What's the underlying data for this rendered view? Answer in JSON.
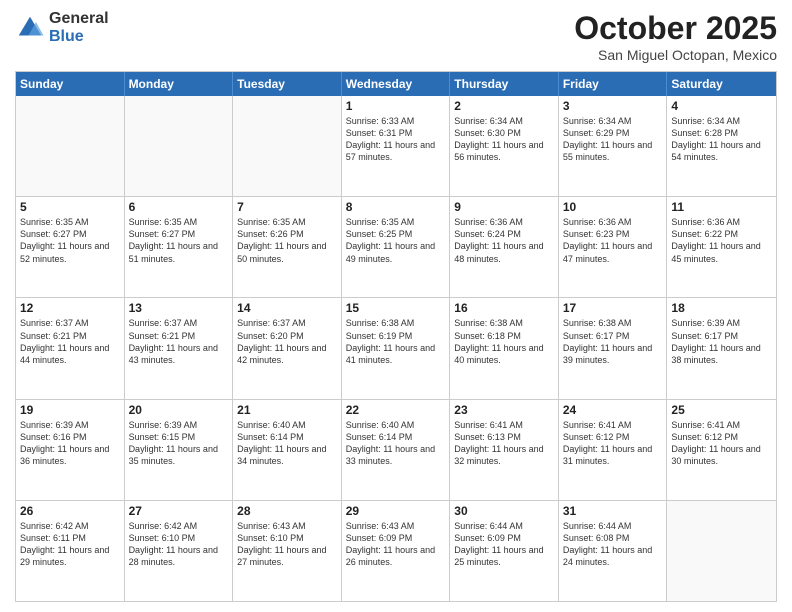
{
  "logo": {
    "general": "General",
    "blue": "Blue"
  },
  "header": {
    "month": "October 2025",
    "location": "San Miguel Octopan, Mexico"
  },
  "weekdays": [
    "Sunday",
    "Monday",
    "Tuesday",
    "Wednesday",
    "Thursday",
    "Friday",
    "Saturday"
  ],
  "rows": [
    [
      {
        "day": "",
        "info": ""
      },
      {
        "day": "",
        "info": ""
      },
      {
        "day": "",
        "info": ""
      },
      {
        "day": "1",
        "info": "Sunrise: 6:33 AM\nSunset: 6:31 PM\nDaylight: 11 hours\nand 57 minutes."
      },
      {
        "day": "2",
        "info": "Sunrise: 6:34 AM\nSunset: 6:30 PM\nDaylight: 11 hours\nand 56 minutes."
      },
      {
        "day": "3",
        "info": "Sunrise: 6:34 AM\nSunset: 6:29 PM\nDaylight: 11 hours\nand 55 minutes."
      },
      {
        "day": "4",
        "info": "Sunrise: 6:34 AM\nSunset: 6:28 PM\nDaylight: 11 hours\nand 54 minutes."
      }
    ],
    [
      {
        "day": "5",
        "info": "Sunrise: 6:35 AM\nSunset: 6:27 PM\nDaylight: 11 hours\nand 52 minutes."
      },
      {
        "day": "6",
        "info": "Sunrise: 6:35 AM\nSunset: 6:27 PM\nDaylight: 11 hours\nand 51 minutes."
      },
      {
        "day": "7",
        "info": "Sunrise: 6:35 AM\nSunset: 6:26 PM\nDaylight: 11 hours\nand 50 minutes."
      },
      {
        "day": "8",
        "info": "Sunrise: 6:35 AM\nSunset: 6:25 PM\nDaylight: 11 hours\nand 49 minutes."
      },
      {
        "day": "9",
        "info": "Sunrise: 6:36 AM\nSunset: 6:24 PM\nDaylight: 11 hours\nand 48 minutes."
      },
      {
        "day": "10",
        "info": "Sunrise: 6:36 AM\nSunset: 6:23 PM\nDaylight: 11 hours\nand 47 minutes."
      },
      {
        "day": "11",
        "info": "Sunrise: 6:36 AM\nSunset: 6:22 PM\nDaylight: 11 hours\nand 45 minutes."
      }
    ],
    [
      {
        "day": "12",
        "info": "Sunrise: 6:37 AM\nSunset: 6:21 PM\nDaylight: 11 hours\nand 44 minutes."
      },
      {
        "day": "13",
        "info": "Sunrise: 6:37 AM\nSunset: 6:21 PM\nDaylight: 11 hours\nand 43 minutes."
      },
      {
        "day": "14",
        "info": "Sunrise: 6:37 AM\nSunset: 6:20 PM\nDaylight: 11 hours\nand 42 minutes."
      },
      {
        "day": "15",
        "info": "Sunrise: 6:38 AM\nSunset: 6:19 PM\nDaylight: 11 hours\nand 41 minutes."
      },
      {
        "day": "16",
        "info": "Sunrise: 6:38 AM\nSunset: 6:18 PM\nDaylight: 11 hours\nand 40 minutes."
      },
      {
        "day": "17",
        "info": "Sunrise: 6:38 AM\nSunset: 6:17 PM\nDaylight: 11 hours\nand 39 minutes."
      },
      {
        "day": "18",
        "info": "Sunrise: 6:39 AM\nSunset: 6:17 PM\nDaylight: 11 hours\nand 38 minutes."
      }
    ],
    [
      {
        "day": "19",
        "info": "Sunrise: 6:39 AM\nSunset: 6:16 PM\nDaylight: 11 hours\nand 36 minutes."
      },
      {
        "day": "20",
        "info": "Sunrise: 6:39 AM\nSunset: 6:15 PM\nDaylight: 11 hours\nand 35 minutes."
      },
      {
        "day": "21",
        "info": "Sunrise: 6:40 AM\nSunset: 6:14 PM\nDaylight: 11 hours\nand 34 minutes."
      },
      {
        "day": "22",
        "info": "Sunrise: 6:40 AM\nSunset: 6:14 PM\nDaylight: 11 hours\nand 33 minutes."
      },
      {
        "day": "23",
        "info": "Sunrise: 6:41 AM\nSunset: 6:13 PM\nDaylight: 11 hours\nand 32 minutes."
      },
      {
        "day": "24",
        "info": "Sunrise: 6:41 AM\nSunset: 6:12 PM\nDaylight: 11 hours\nand 31 minutes."
      },
      {
        "day": "25",
        "info": "Sunrise: 6:41 AM\nSunset: 6:12 PM\nDaylight: 11 hours\nand 30 minutes."
      }
    ],
    [
      {
        "day": "26",
        "info": "Sunrise: 6:42 AM\nSunset: 6:11 PM\nDaylight: 11 hours\nand 29 minutes."
      },
      {
        "day": "27",
        "info": "Sunrise: 6:42 AM\nSunset: 6:10 PM\nDaylight: 11 hours\nand 28 minutes."
      },
      {
        "day": "28",
        "info": "Sunrise: 6:43 AM\nSunset: 6:10 PM\nDaylight: 11 hours\nand 27 minutes."
      },
      {
        "day": "29",
        "info": "Sunrise: 6:43 AM\nSunset: 6:09 PM\nDaylight: 11 hours\nand 26 minutes."
      },
      {
        "day": "30",
        "info": "Sunrise: 6:44 AM\nSunset: 6:09 PM\nDaylight: 11 hours\nand 25 minutes."
      },
      {
        "day": "31",
        "info": "Sunrise: 6:44 AM\nSunset: 6:08 PM\nDaylight: 11 hours\nand 24 minutes."
      },
      {
        "day": "",
        "info": ""
      }
    ]
  ]
}
